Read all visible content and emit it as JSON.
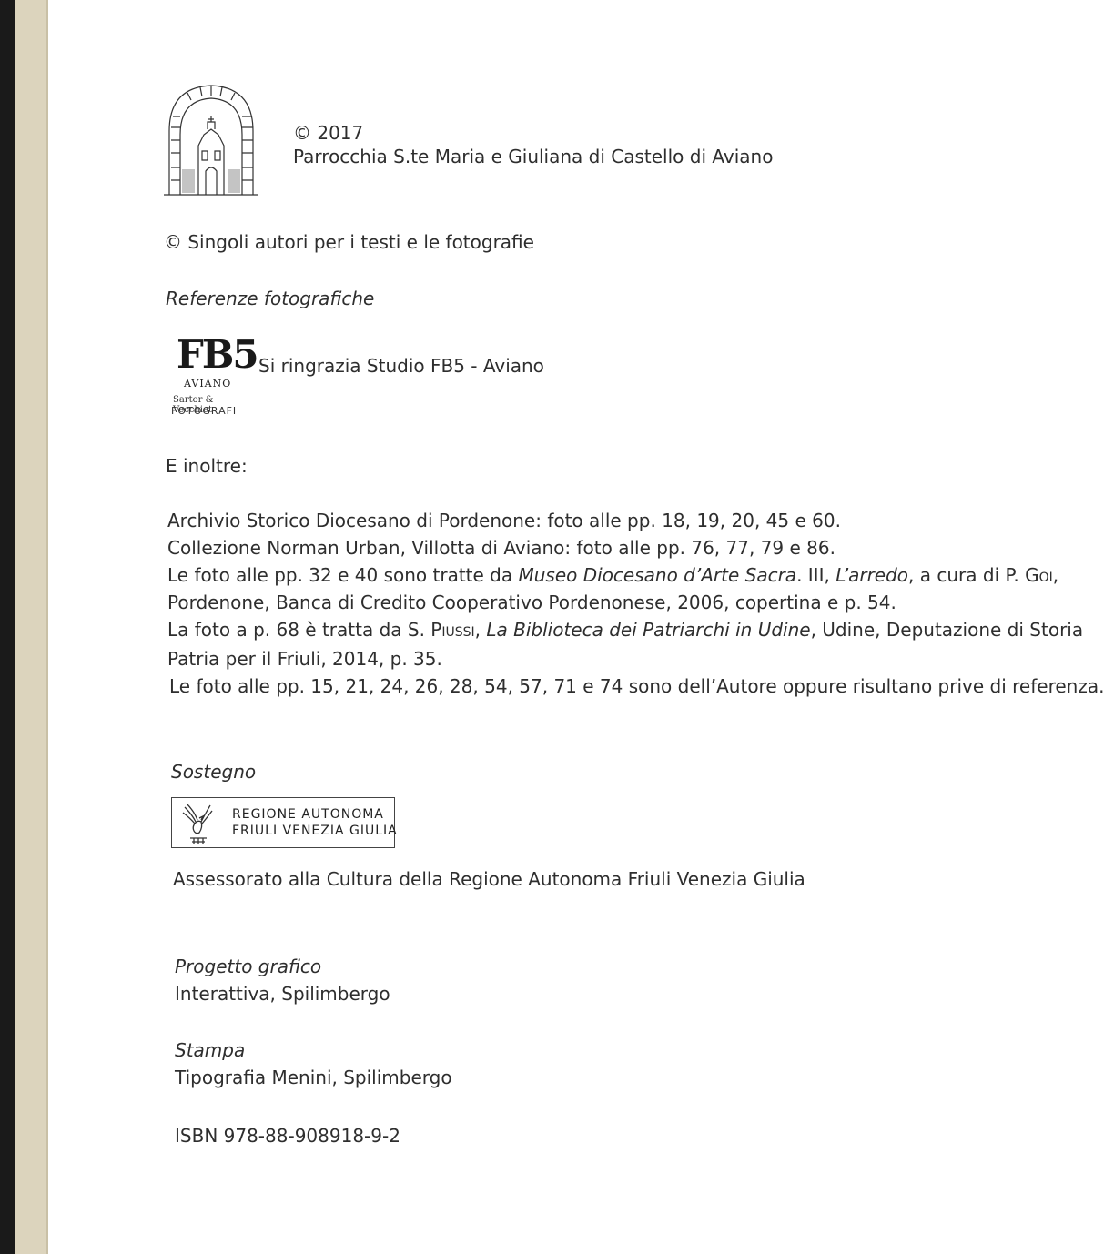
{
  "header": {
    "copyright_year": "© 2017",
    "publisher": "Parrocchia S.te Maria e Giuliana di Castello di Aviano"
  },
  "authors_rights": "© Singoli autori per i testi e le fotografie",
  "photo_refs": {
    "heading": "Referenze fotografiche",
    "fb5_logo": {
      "name": "FB5",
      "city": "AVIANO",
      "signature": "Sartor & Vecchiet",
      "fotografi": "FOTOGRAFI"
    },
    "thanks": "Si ringrazia Studio FB5 - Aviano"
  },
  "inoltre": "E inoltre:",
  "credits": {
    "l1": "Archivio Storico Diocesano di Pordenone: foto alle pp. 18, 19, 20, 45 e 60.",
    "l2": "Collezione Norman Urban, Villotta di Aviano: foto alle pp. 76, 77, 79 e 86.",
    "l3a": "Le foto alle pp. 32 e 40 sono tratte da ",
    "l3b": "Museo Diocesano d’Arte Sacra",
    "l3c": ". III, ",
    "l3d": "L’arredo",
    "l3e": ", a cura di P. ",
    "l3f": "Goi",
    "l3g": ",",
    "l4": "Pordenone, Banca di Credito Cooperativo Pordenonese, 2006, copertina e p. 54.",
    "l5a": "La foto a p. 68 è tratta da S. ",
    "l5b": "Piussi",
    "l5c": ", ",
    "l5d": "La Biblioteca dei Patriarchi in Udine",
    "l5e": ", Udine, Deputazione di Storia",
    "l6": "Patria per il Friuli, 2014, p. 35.",
    "l7": "Le foto alle pp. 15, 21, 24, 26, 28, 54, 57, 71 e 74 sono dell’Autore oppure risultano prive di referenza."
  },
  "support": {
    "heading": "Sostegno",
    "region_line1": "REGIONE AUTONOMA",
    "region_line2": "FRIULI VENEZIA GIULIA",
    "text": "Assessorato alla Cultura della Regione Autonoma Friuli Venezia Giulia"
  },
  "design": {
    "heading": "Progetto grafico",
    "text": "Interattiva, Spilimbergo"
  },
  "print": {
    "heading": "Stampa",
    "text": "Tipografia Menini, Spilimbergo"
  },
  "isbn": "ISBN 978-88-908918-9-2",
  "icons": {
    "church": "church-arch-icon",
    "eagle": "eagle-icon"
  }
}
